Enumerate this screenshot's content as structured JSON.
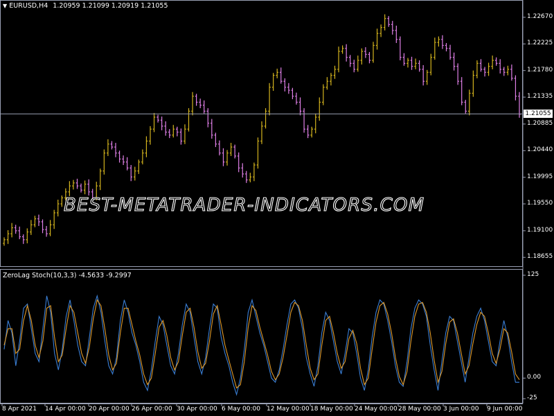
{
  "header": {
    "symbol_timeframe": "EURUSD,H4",
    "ohlc": "1.20959 1.21099 1.20919 1.21055",
    "collapse_icon": "triangle-down-icon"
  },
  "indicator": {
    "label": "ZeroLag Stoch(10,3,3) -4.5633 -9.2997",
    "scale_labels": [
      "125",
      "0.00",
      "-25"
    ]
  },
  "price_axis": {
    "labels": [
      "1.22670",
      "1.22225",
      "1.21780",
      "1.21335",
      "1.20885",
      "1.20440",
      "1.19995",
      "1.19550",
      "1.19100",
      "1.18655"
    ],
    "current_price": "1.21055"
  },
  "time_axis": {
    "labels": [
      "8 Apr 2021",
      "14 Apr 00:00",
      "20 Apr 00:00",
      "26 Apr 00:00",
      "30 Apr 00:00",
      "6 May 00:00",
      "12 May 00:00",
      "18 May 00:00",
      "24 May 00:00",
      "28 May 00:00",
      "3 Jun 00:00",
      "9 Jun 00:00"
    ]
  },
  "watermark": "BEST-METATRADER-INDICATORS.COM",
  "colors": {
    "background": "#000000",
    "bull_candle": "#d4b41e",
    "bear_candle": "#e080e8",
    "stoch_main": "#3a7fd6",
    "stoch_signal": "#e09a2a",
    "grid_line": "#9aa0b4"
  },
  "chart_data": [
    {
      "type": "candlestick",
      "title": "EURUSD,H4",
      "ylim": [
        1.1853,
        1.2282
      ],
      "current_price": 1.21055,
      "close": [
        1.1895,
        1.1905,
        1.1915,
        1.191,
        1.19,
        1.1895,
        1.1908,
        1.192,
        1.193,
        1.1925,
        1.1912,
        1.1905,
        1.192,
        1.194,
        1.1955,
        1.1965,
        1.1975,
        1.1985,
        1.199,
        1.1985,
        1.1978,
        1.1988,
        1.1975,
        1.1965,
        1.1985,
        1.201,
        1.204,
        1.2055,
        1.205,
        1.204,
        1.203,
        1.2025,
        1.2015,
        1.2,
        1.201,
        1.2025,
        1.204,
        1.206,
        1.208,
        1.21,
        1.2095,
        1.2085,
        1.2075,
        1.207,
        1.208,
        1.2075,
        1.206,
        1.208,
        1.211,
        1.2135,
        1.2125,
        1.212,
        1.211,
        1.209,
        1.207,
        1.2055,
        1.204,
        1.2025,
        1.204,
        1.205,
        1.2035,
        1.2015,
        1.2005,
        1.1995,
        1.2,
        1.202,
        1.206,
        1.2085,
        1.211,
        1.215,
        1.217,
        1.2175,
        1.216,
        1.215,
        1.2145,
        1.2135,
        1.2125,
        1.211,
        1.208,
        1.207,
        1.208,
        1.21,
        1.2125,
        1.215,
        1.216,
        1.217,
        1.218,
        1.221,
        1.2215,
        1.22,
        1.219,
        1.218,
        1.2195,
        1.221,
        1.2205,
        1.2195,
        1.222,
        1.224,
        1.225,
        1.2265,
        1.2255,
        1.2245,
        1.223,
        1.22,
        1.219,
        1.2195,
        1.2185,
        1.219,
        1.218,
        1.216,
        1.2175,
        1.22,
        1.2225,
        1.223,
        1.222,
        1.2215,
        1.22,
        1.2185,
        1.216,
        1.2125,
        1.211,
        1.214,
        1.217,
        1.219,
        1.218,
        1.2175,
        1.2185,
        1.2195,
        1.219,
        1.218,
        1.2175,
        1.218,
        1.2165,
        1.2135,
        1.2105
      ],
      "high_ylabel_hint": "OHLC bars"
    },
    {
      "type": "line",
      "title": "ZeroLag Stoch(10,3,3)",
      "ylim": [
        -25,
        125
      ],
      "series": [
        {
          "values": [
            35,
            70,
            55,
            15,
            45,
            85,
            90,
            60,
            30,
            20,
            60,
            100,
            80,
            30,
            10,
            35,
            75,
            95,
            70,
            40,
            20,
            15,
            50,
            85,
            100,
            80,
            45,
            15,
            5,
            25,
            70,
            95,
            80,
            55,
            40,
            20,
            -5,
            -15,
            10,
            45,
            75,
            65,
            40,
            15,
            5,
            30,
            65,
            90,
            80,
            50,
            20,
            5,
            25,
            60,
            90,
            85,
            50,
            30,
            15,
            -5,
            -20,
            0,
            35,
            80,
            95,
            75,
            55,
            40,
            20,
            0,
            -5,
            10,
            35,
            65,
            90,
            95,
            85,
            60,
            25,
            5,
            -10,
            15,
            55,
            80,
            70,
            45,
            20,
            5,
            30,
            60,
            55,
            30,
            0,
            -15,
            10,
            50,
            80,
            95,
            90,
            70,
            45,
            15,
            -5,
            -10,
            20,
            60,
            85,
            95,
            90,
            75,
            40,
            10,
            -15,
            20,
            55,
            75,
            70,
            45,
            20,
            -5,
            25,
            55,
            75,
            85,
            70,
            45,
            20,
            15,
            45,
            70,
            50,
            20,
            -5,
            -5
          ]
        },
        {
          "values": [
            40,
            60,
            60,
            30,
            35,
            70,
            88,
            70,
            40,
            25,
            45,
            85,
            88,
            50,
            20,
            28,
            60,
            88,
            80,
            55,
            30,
            18,
            38,
            72,
            95,
            88,
            60,
            28,
            10,
            18,
            55,
            85,
            85,
            65,
            45,
            28,
            5,
            -8,
            0,
            30,
            62,
            70,
            52,
            25,
            10,
            20,
            52,
            80,
            85,
            62,
            32,
            12,
            18,
            45,
            78,
            88,
            65,
            40,
            22,
            5,
            -12,
            -8,
            20,
            62,
            88,
            82,
            62,
            45,
            28,
            8,
            -2,
            5,
            25,
            52,
            80,
            92,
            88,
            70,
            40,
            12,
            -2,
            5,
            40,
            70,
            75,
            55,
            30,
            12,
            20,
            48,
            58,
            42,
            12,
            -8,
            0,
            35,
            68,
            88,
            92,
            78,
            55,
            25,
            2,
            -8,
            8,
            45,
            75,
            90,
            92,
            80,
            55,
            22,
            -5,
            8,
            42,
            68,
            72,
            55,
            30,
            5,
            15,
            42,
            65,
            80,
            75,
            55,
            30,
            18,
            35,
            60,
            55,
            32,
            5,
            -2
          ]
        }
      ]
    }
  ]
}
